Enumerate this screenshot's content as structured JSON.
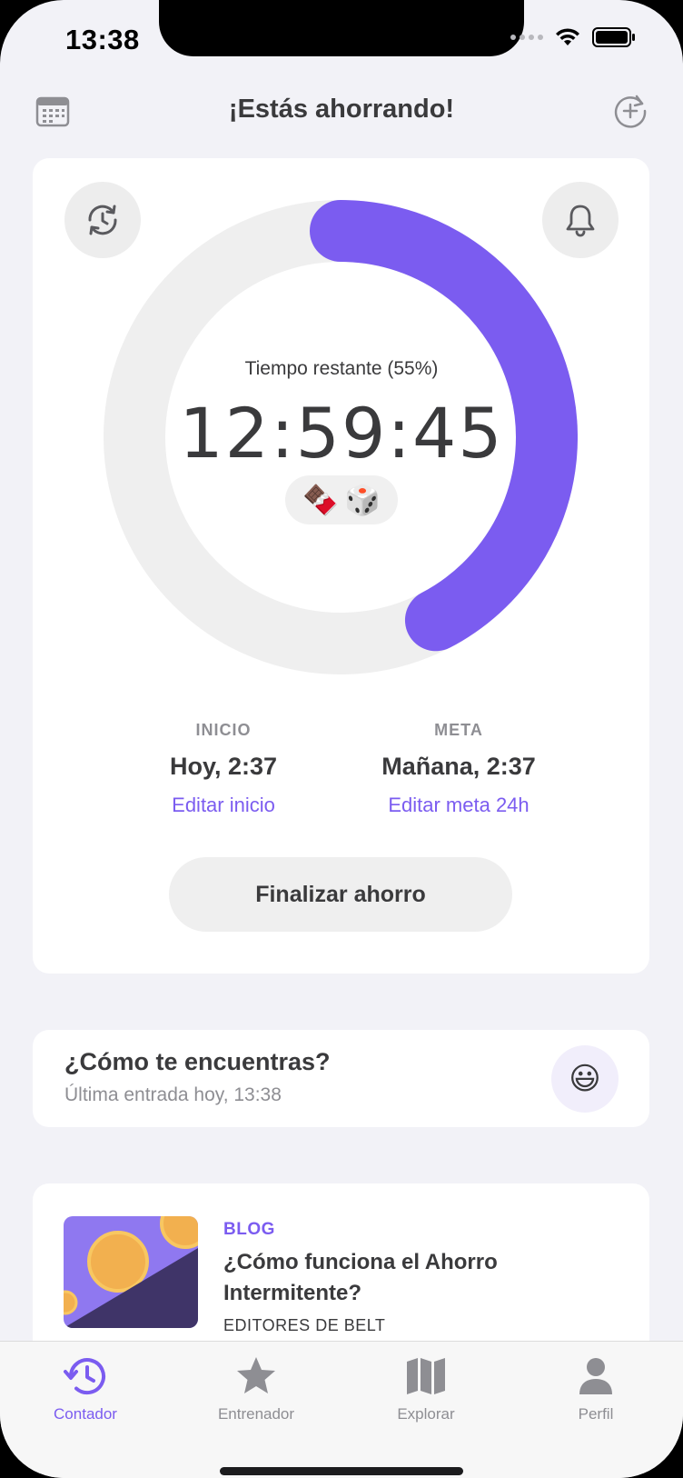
{
  "status_bar": {
    "time": "13:38"
  },
  "header": {
    "title": "¡Estás ahorrando!",
    "left_icon": "calendar-icon",
    "right_icon": "add-circle-icon"
  },
  "timer": {
    "remaining_label": "Tiempo restante (55%)",
    "progress": 0.55,
    "countdown": "12:59:45",
    "emojis": [
      "🍫",
      "🎲"
    ],
    "accent_color": "#7b5cf0",
    "track_color": "#efefef"
  },
  "schedule": {
    "start": {
      "label": "INICIO",
      "value": "Hoy, 2:37",
      "link": "Editar inicio"
    },
    "goal": {
      "label": "META",
      "value": "Mañana, 2:37",
      "link": "Editar meta 24h"
    }
  },
  "end_button": "Finalizar ahorro",
  "mood": {
    "title": "¿Cómo te encuentras?",
    "subtitle": "Última entrada hoy, 13:38",
    "emoji": "😃"
  },
  "blog": {
    "tag": "BLOG",
    "title": "¿Cómo funciona el Ahorro Intermitente?",
    "author": "EDITORES DE BELT"
  },
  "tabs": [
    {
      "label": "Contador",
      "icon": "history-clock-icon",
      "active": true
    },
    {
      "label": "Entrenador",
      "icon": "star-icon",
      "active": false
    },
    {
      "label": "Explorar",
      "icon": "map-icon",
      "active": false
    },
    {
      "label": "Perfil",
      "icon": "person-icon",
      "active": false
    }
  ]
}
